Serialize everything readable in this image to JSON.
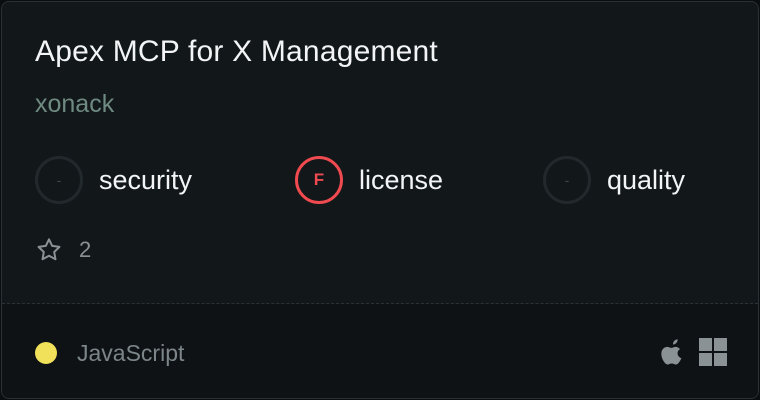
{
  "server": {
    "title": "Apex MCP for X Management",
    "author": "xonack"
  },
  "scores": [
    {
      "grade": "-",
      "label": "security",
      "state": "empty"
    },
    {
      "grade": "F",
      "label": "license",
      "state": "fail"
    },
    {
      "grade": "-",
      "label": "quality",
      "state": "empty"
    }
  ],
  "stars": {
    "count": "2",
    "icon": "star-outline-icon"
  },
  "language": {
    "name": "JavaScript",
    "color": "#f1e05a"
  },
  "platforms": [
    {
      "icon": "apple-icon"
    },
    {
      "icon": "windows-icon"
    }
  ],
  "colors": {
    "fail": "#ee4a4f",
    "card_background": "#12171a",
    "author": "#6f8a80"
  }
}
